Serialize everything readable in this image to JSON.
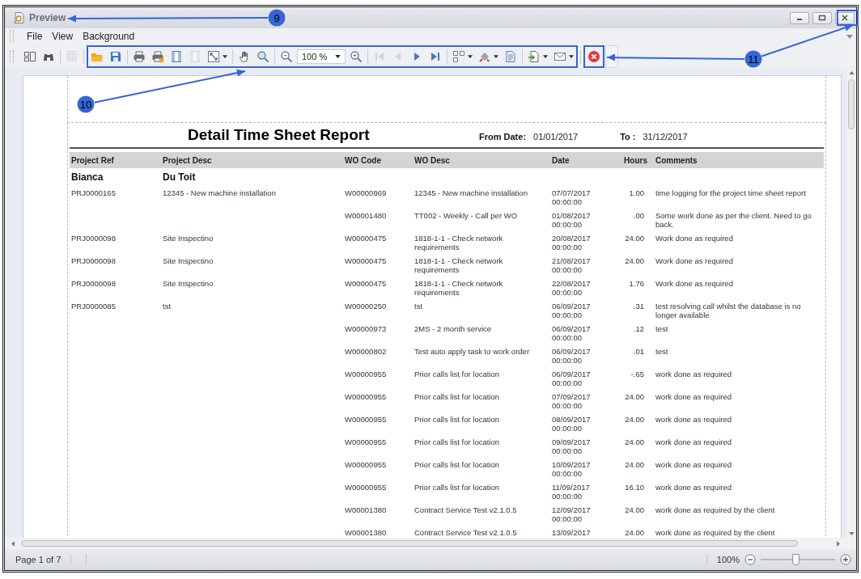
{
  "window": {
    "title": "Preview"
  },
  "menu": [
    {
      "label": "File"
    },
    {
      "label": "View"
    },
    {
      "label": "Background"
    }
  ],
  "toolbar": {
    "sections": [
      {
        "groups": [
          {
            "items": [
              {
                "kind": "panes",
                "disabled": false,
                "dropdown": false
              },
              {
                "kind": "find",
                "disabled": false,
                "dropdown": false
              }
            ]
          },
          {
            "items": [
              {
                "kind": "grid",
                "disabled": true,
                "dropdown": false
              }
            ]
          }
        ]
      },
      {
        "groups": [
          {
            "items": [
              {
                "kind": "open",
                "disabled": false,
                "dropdown": false
              },
              {
                "kind": "save",
                "disabled": false,
                "dropdown": false
              }
            ]
          },
          {
            "items": [
              {
                "kind": "print",
                "disabled": false,
                "dropdown": false
              },
              {
                "kind": "quick-print",
                "disabled": false,
                "dropdown": false
              },
              {
                "kind": "page-setup",
                "disabled": false,
                "dropdown": false
              },
              {
                "kind": "margins",
                "disabled": true,
                "dropdown": false
              },
              {
                "kind": "scale",
                "disabled": false,
                "dropdown": true
              }
            ]
          },
          {
            "items": [
              {
                "kind": "hand",
                "disabled": false,
                "dropdown": false
              },
              {
                "kind": "magnifier",
                "disabled": false,
                "dropdown": false
              }
            ]
          },
          {
            "items": [
              {
                "kind": "zoom-out",
                "disabled": false,
                "dropdown": false
              },
              {
                "kind": "zoom-combo",
                "value": "100 %",
                "disabled": false,
                "dropdown": true
              },
              {
                "kind": "zoom-in",
                "disabled": false,
                "dropdown": false
              }
            ]
          },
          {
            "items": [
              {
                "kind": "first",
                "disabled": true,
                "dropdown": false
              },
              {
                "kind": "previous",
                "disabled": true,
                "dropdown": false
              },
              {
                "kind": "next",
                "disabled": false,
                "dropdown": false
              },
              {
                "kind": "last",
                "disabled": false,
                "dropdown": false
              }
            ]
          },
          {
            "items": [
              {
                "kind": "multipage",
                "disabled": false,
                "dropdown": true
              },
              {
                "kind": "color",
                "disabled": false,
                "dropdown": true
              },
              {
                "kind": "watermark",
                "disabled": false,
                "dropdown": false
              }
            ]
          },
          {
            "items": [
              {
                "kind": "export",
                "disabled": false,
                "dropdown": true
              },
              {
                "kind": "email",
                "disabled": false,
                "dropdown": true
              }
            ]
          }
        ]
      },
      {
        "groups": [
          {
            "items": [
              {
                "kind": "close-preview",
                "disabled": false,
                "dropdown": false
              }
            ]
          }
        ]
      }
    ]
  },
  "report": {
    "title": "Detail Time Sheet Report",
    "from_label": "From Date:",
    "from_value": "01/01/2017",
    "to_label": "To :",
    "to_value": "31/12/2017",
    "columns": [
      "Project Ref",
      "Project Desc",
      "WO Code",
      "WO Desc",
      "Date",
      "Hours",
      "Comments"
    ],
    "group": {
      "first_name": "Bianca",
      "last_name": "Du Toit"
    },
    "rows": [
      {
        "project_ref": "PRJ0000165",
        "project_desc": "12345 - New machine installation",
        "wo_code": "W00000969",
        "wo_desc": "12345 - New machine installation",
        "date": "07/07/2017",
        "time": "00:00:00",
        "hours": "1.00",
        "comments": "time logging for the project time sheet report"
      },
      {
        "project_ref": "",
        "project_desc": "",
        "wo_code": "W00001480",
        "wo_desc": "TT002 - Weekly - Call per WO",
        "date": "01/08/2017",
        "time": "00:00:00",
        "hours": ".00",
        "comments": "Some work done as per the client. Need to go back."
      },
      {
        "project_ref": "PRJ0000098",
        "project_desc": "Site Inspectino",
        "wo_code": "W00000475",
        "wo_desc": "1818-1-1 - Check network requirements",
        "date": "20/08/2017",
        "time": "00:00:00",
        "hours": "24.00",
        "comments": "Work done as required"
      },
      {
        "project_ref": "PRJ0000098",
        "project_desc": "Site Inspectino",
        "wo_code": "W00000475",
        "wo_desc": "1818-1-1 - Check network requirements",
        "date": "21/08/2017",
        "time": "00:00:00",
        "hours": "24.00",
        "comments": "Work done as required"
      },
      {
        "project_ref": "PRJ0000098",
        "project_desc": "Site Inspectino",
        "wo_code": "W00000475",
        "wo_desc": "1818-1-1 - Check network requirements",
        "date": "22/08/2017",
        "time": "00:00:00",
        "hours": "1.76",
        "comments": "Work done as required"
      },
      {
        "project_ref": "PRJ0000085",
        "project_desc": "tst",
        "wo_code": "W00000250",
        "wo_desc": "tst",
        "date": "06/09/2017",
        "time": "00:00:00",
        "hours": ".31",
        "comments": "test resolving call whilst the database is no longer available"
      },
      {
        "project_ref": "",
        "project_desc": "",
        "wo_code": "W00000973",
        "wo_desc": "2MS - 2 month service",
        "date": "06/09/2017",
        "time": "00:00:00",
        "hours": ".12",
        "comments": "test"
      },
      {
        "project_ref": "",
        "project_desc": "",
        "wo_code": "W00000802",
        "wo_desc": "Test auto apply task to work order",
        "date": "06/09/2017",
        "time": "00:00:00",
        "hours": ".01",
        "comments": "test"
      },
      {
        "project_ref": "",
        "project_desc": "",
        "wo_code": "W00000955",
        "wo_desc": "Prior calls list for location",
        "date": "06/09/2017",
        "time": "00:00:00",
        "hours": "-.65",
        "comments": "work done as required"
      },
      {
        "project_ref": "",
        "project_desc": "",
        "wo_code": "W00000955",
        "wo_desc": "Prior calls list for location",
        "date": "07/09/2017",
        "time": "00:00:00",
        "hours": "24.00",
        "comments": "work done as required"
      },
      {
        "project_ref": "",
        "project_desc": "",
        "wo_code": "W00000955",
        "wo_desc": "Prior calls list for location",
        "date": "08/09/2017",
        "time": "00:00:00",
        "hours": "24.00",
        "comments": "work done as required"
      },
      {
        "project_ref": "",
        "project_desc": "",
        "wo_code": "W00000955",
        "wo_desc": "Prior calls list for location",
        "date": "09/09/2017",
        "time": "00:00:00",
        "hours": "24.00",
        "comments": "work done as required"
      },
      {
        "project_ref": "",
        "project_desc": "",
        "wo_code": "W00000955",
        "wo_desc": "Prior calls list for location",
        "date": "10/09/2017",
        "time": "00:00:00",
        "hours": "24.00",
        "comments": "work done as required"
      },
      {
        "project_ref": "",
        "project_desc": "",
        "wo_code": "W00000955",
        "wo_desc": "Prior calls list for location",
        "date": "11/09/2017",
        "time": "00:00:00",
        "hours": "16.10",
        "comments": "work done as required"
      },
      {
        "project_ref": "",
        "project_desc": "",
        "wo_code": "W00001380",
        "wo_desc": "Contract Service Test v2.1.0.5",
        "date": "12/09/2017",
        "time": "00:00:00",
        "hours": "24.00",
        "comments": "work done as required by the client"
      },
      {
        "project_ref": "",
        "project_desc": "",
        "wo_code": "W00001380",
        "wo_desc": "Contract Service Test v2.1.0.5",
        "date": "13/09/2017",
        "hours": "24.00",
        "comments": "work done as required by the client"
      }
    ]
  },
  "status_bar": {
    "page": "Page 1 of 7",
    "zoom": "100%",
    "zoom_slider": {
      "level": 0.48
    }
  },
  "callouts": [
    {
      "number": "9"
    },
    {
      "number": "10"
    },
    {
      "number": "11"
    }
  ]
}
